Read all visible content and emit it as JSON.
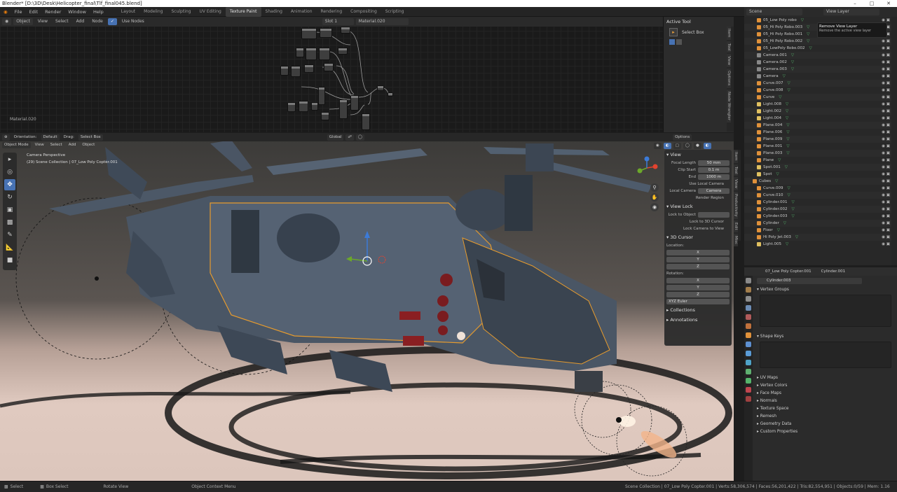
{
  "window": {
    "title": "Blender* [D:\\3D\\Desk\\Helicopter_final\\Tlf_final045.blend]"
  },
  "menu": {
    "items": [
      "File",
      "Edit",
      "Render",
      "Window",
      "Help"
    ],
    "workspaces": [
      "Layout",
      "Modeling",
      "Sculpting",
      "UV Editing",
      "Texture Paint",
      "Shading",
      "Animation",
      "Rendering",
      "Compositing",
      "Scripting"
    ],
    "active_workspace": "Texture Paint",
    "scene_label": "Scene",
    "view_layer_label": "View Layer"
  },
  "node_editor": {
    "mode": "Object",
    "menu": [
      "View",
      "Select",
      "Add",
      "Node"
    ],
    "use_nodes": "Use Nodes",
    "slot": "Slot 1",
    "material": "Material.020",
    "material_label": "Material.020",
    "active_tool_title": "Active Tool",
    "tool_name": "Select Box",
    "side_tabs": [
      "Item",
      "Tool",
      "View",
      "Options",
      "Node Wrangler"
    ]
  },
  "viewport": {
    "orientation": "Orientation:",
    "orientation_value": "Default",
    "drag": "Drag:",
    "drag_value": "Select Box",
    "shading": "Global",
    "mode": "Object Mode",
    "menu": [
      "View",
      "Select",
      "Add",
      "Object"
    ],
    "options": "Options",
    "camera_label": "Camera Perspective",
    "collection_label": "(29) Scene Collection | 07_Low Poly Copter.001",
    "side_tabs": [
      "Item",
      "Tool",
      "View",
      "Productivity",
      "Edit",
      "Misc"
    ]
  },
  "npanel": {
    "view_title": "View",
    "focal_length_label": "Focal Length",
    "focal_length": "50 mm",
    "clip_start_label": "Clip Start",
    "clip_start": "0.1 m",
    "clip_end_label": "End",
    "clip_end": "1000 m",
    "local_camera": "Use Local Camera",
    "local_camera_label": "Local Camera",
    "local_camera_value": "Camera",
    "render_region": "Render Region",
    "view_lock_title": "View Lock",
    "lock_to_object": "Lock to Object",
    "lock_to_3d_cursor": "Lock to 3D Cursor",
    "lock_camera_to_view": "Lock Camera to View",
    "cursor_title": "3D Cursor",
    "location_label": "Location:",
    "loc": [
      "X",
      "Y",
      "Z"
    ],
    "rotation_label": "Rotation:",
    "rot": [
      "X",
      "Y",
      "Z"
    ],
    "rotation_mode": "XYZ Euler",
    "collections": "Collections",
    "annotations": "Annotations"
  },
  "outliner": {
    "header": "Scene",
    "view_layer": "View Layer",
    "tooltip_title": "Remove View Layer",
    "tooltip_body": "Remove the active view layer",
    "items": [
      "05_Low Poly robo",
      "05_Hi Poly Robo.003",
      "05_Hi Poly Robo.001",
      "05_Hi Poly Robo.002",
      "05_LowPoly Robo.002",
      "Camera.001",
      "Camera.002",
      "Camera.003",
      "Camera",
      "Curve.007",
      "Curve.008",
      "Curve",
      "Light.008",
      "Light.002",
      "Light.004",
      "Plane.004",
      "Plane.006",
      "Plane.009",
      "Plane.001",
      "Plane.003",
      "Plane",
      "Spot.001",
      "Spot",
      "Cubes",
      "Curve.009",
      "Curve.010",
      "Cylinder.001",
      "Cylinder.002",
      "Cylinder.003",
      "Cylinder",
      "Floor",
      "Hi Poly Jet.003",
      "Light.005"
    ]
  },
  "properties": {
    "object": "07_Low Poly Copter.001",
    "data": "Cylinder.001",
    "mesh_name": "Cylinder.003",
    "sections": [
      "Vertex Groups",
      "Shape Keys",
      "UV Maps",
      "Vertex Colors",
      "Face Maps",
      "Normals",
      "Texture Space",
      "Remesh",
      "Geometry Data",
      "Custom Properties"
    ]
  },
  "status": {
    "select": "Select",
    "box_select": "Box Select",
    "rotate_view": "Rotate View",
    "context_menu": "Object Context Menu",
    "stats": "Scene Collection | 07_Low Poly Copter.001 | Verts:58,306,574 | Faces:56,201,422 | Tris:82,554,951 | Objects:0/59 | Mem: 1.16 GiB"
  },
  "colors": {
    "accent": "#4772b3",
    "selection": "#e69b2e",
    "gizmo_x": "#e2432f",
    "gizmo_y": "#6ca82a",
    "gizmo_z": "#3c7bd8"
  }
}
